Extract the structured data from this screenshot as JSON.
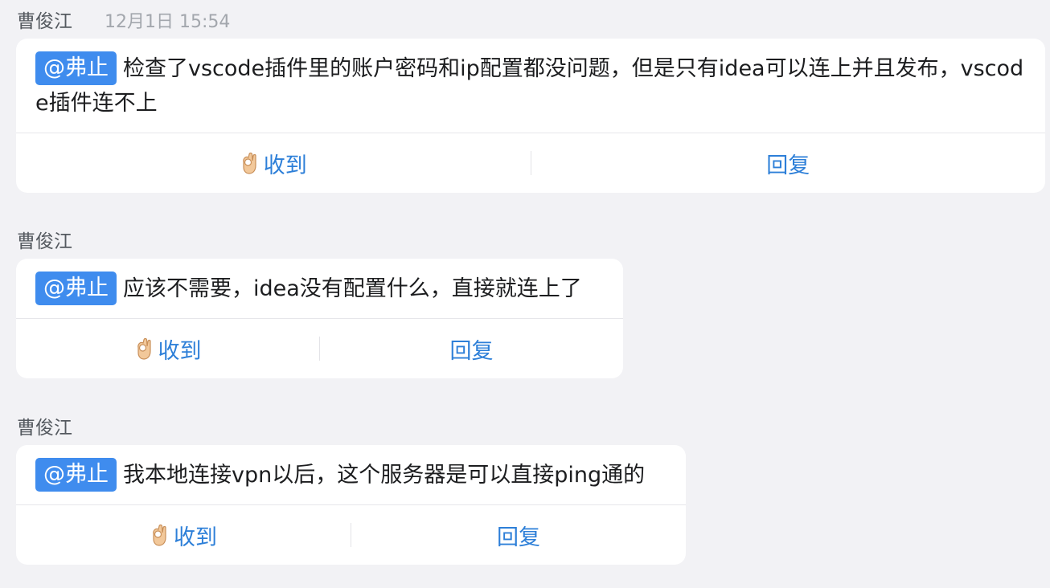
{
  "messages": [
    {
      "sender": "曹俊江",
      "time": "12月1日 15:54",
      "mention": "@弗止",
      "text": "检查了vscode插件里的账户密码和ip配置都没问题，但是只有idea可以连上并且发布，vscode插件连不上",
      "ack_label": "收到",
      "reply_label": "回复"
    },
    {
      "sender": "曹俊江",
      "time": "",
      "mention": "@弗止",
      "text": "应该不需要，idea没有配置什么，直接就连上了",
      "ack_label": "收到",
      "reply_label": "回复"
    },
    {
      "sender": "曹俊江",
      "time": "",
      "mention": "@弗止",
      "text": "我本地连接vpn以后，这个服务器是可以直接ping通的",
      "ack_label": "收到",
      "reply_label": "回复"
    }
  ],
  "icons": {
    "ack": "ok-hand-icon"
  },
  "colors": {
    "background": "#f2f2f5",
    "card": "#ffffff",
    "mention_bg": "#3f8cee",
    "action_text": "#2d7fd8",
    "sender_text": "#555a60",
    "time_text": "#a3a7ad"
  }
}
